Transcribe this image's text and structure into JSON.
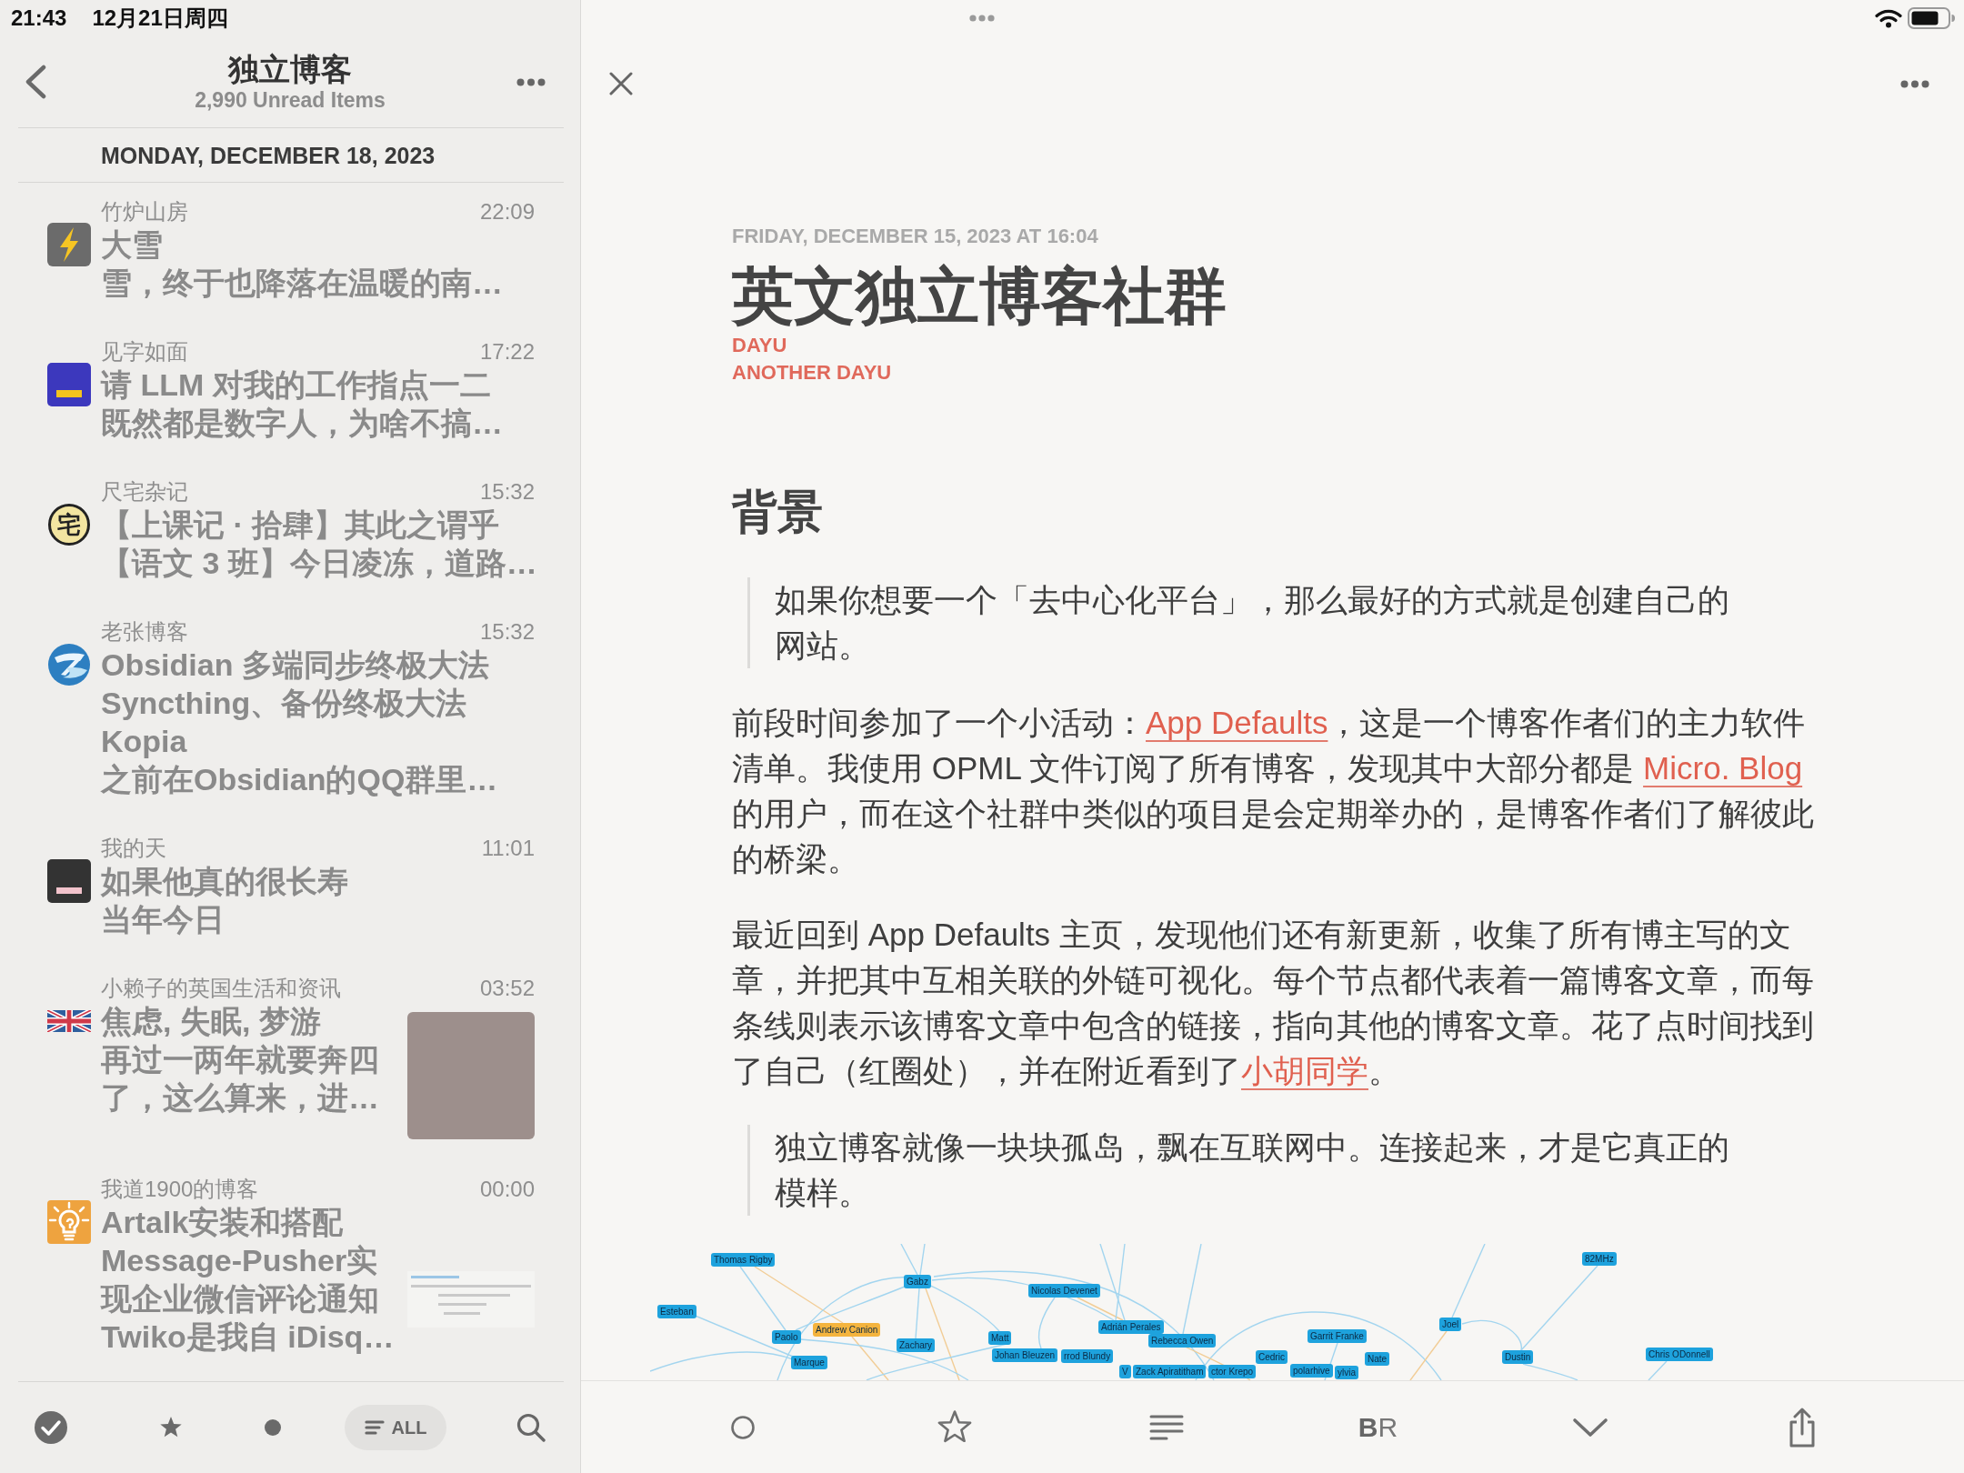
{
  "status_bar": {
    "time": "21:43",
    "date": "12月21日周四"
  },
  "feed_list": {
    "title": "独立博客",
    "subtitle": "2,990 Unread Items",
    "date_header": "MONDAY, DECEMBER 18, 2023",
    "items": [
      {
        "source": "竹炉山房",
        "time": "22:09",
        "title": "大雪",
        "summary": "雪，终于也降落在温暖的南…"
      },
      {
        "source": "见字如面",
        "time": "17:22",
        "title": "请 LLM 对我的工作指点一二",
        "summary": "既然都是数字人，为啥不搞…"
      },
      {
        "source": "尺宅杂记",
        "time": "15:32",
        "logo_text": "宅",
        "title": "【上课记 · 拾肆】其此之谓乎",
        "summary": "【语文 3 班】今日凌冻，道路…"
      },
      {
        "source": "老张博客",
        "time": "15:32",
        "title": "Obsidian 多端同步终极大法 Syncthing、备份终极大法 Kopia",
        "summary": "之前在Obsidian的QQ群里…"
      },
      {
        "source": "我的天",
        "time": "11:01",
        "title": "如果他真的很长寿",
        "summary": "当年今日"
      },
      {
        "source": "小赖子的英国生活和资讯",
        "time": "03:52",
        "title": "焦虑, 失眠, 梦游",
        "summary": "再过一两年就要奔四了，这么算来，进…",
        "thumbnail": {
          "kind": "photo"
        }
      },
      {
        "source": "我道1900的博客",
        "time": "00:00",
        "title": "Artalk安装和搭配 Message-Pusher实现企业微信评论通知",
        "summary": "Twiko是我自 iDisq…",
        "thumbnail": {
          "kind": "document"
        }
      }
    ]
  },
  "list_toolbar": {
    "filters": [
      {
        "kind": "starred",
        "selected": false
      },
      {
        "kind": "unread",
        "selected": false
      },
      {
        "kind": "all",
        "label": "ALL",
        "selected": true
      }
    ]
  },
  "article": {
    "dateline": "FRIDAY, DECEMBER 15, 2023 AT 16:04",
    "title": "英文独立博客社群",
    "authors": [
      "DAYU",
      "ANOTHER DAYU"
    ],
    "blocks": [
      {
        "kind": "heading",
        "text": "背景"
      },
      {
        "kind": "quote",
        "text": "如果你想要一个「去中心化平台」，那么最好的方式就是创建自己的网站。"
      },
      {
        "kind": "paragraph",
        "segments": [
          {
            "kind": "text",
            "text": "前段时间参加了一个小活动："
          },
          {
            "kind": "link",
            "text": "App Defaults"
          },
          {
            "kind": "text",
            "text": "，这是一个博客作者们的主力软件清单。我使用 OPML 文件订阅了所有博客，发现其中大部分都是 "
          },
          {
            "kind": "link",
            "text": "Micro. Blog"
          },
          {
            "kind": "text",
            "text": "的用户，而在这个社群中类似的项目是会定期举办的，是博客作者们了解彼此的桥梁。"
          }
        ]
      },
      {
        "kind": "paragraph",
        "segments": [
          {
            "kind": "text",
            "text": "最近回到 App Defaults 主页，发现他们还有新更新，收集了所有博主写的文章，并把其中互相关联的外链可视化。每个节点都代表着一篇博客文章，而每条线则表示该博客文章中包含的链接，指向其他的博客文章。花了点时间找到了自己（红圈处），并在附近看到了"
          },
          {
            "kind": "link",
            "text": "小胡同学"
          },
          {
            "kind": "text",
            "text": "。"
          }
        ]
      },
      {
        "kind": "quote",
        "text": "独立博客就像一块块孤岛，飘在互联网中。连接起来，才是它真正的模样。"
      },
      {
        "kind": "graph_image",
        "nodes": [
          {
            "label": "Thomas Rigby",
            "color": "#1ea2dd"
          },
          {
            "label": "82MHz",
            "color": "#1ea2dd"
          },
          {
            "label": "Gabz",
            "color": "#1ea2dd"
          },
          {
            "label": "Nicolas Devenet",
            "color": "#1ea2dd"
          },
          {
            "label": "Esteban",
            "color": "#1ea2dd"
          },
          {
            "label": "Paolo",
            "color": "#1ea2dd"
          },
          {
            "label": "Andrew Canion",
            "color": "#f4b43e"
          },
          {
            "label": "Zachary",
            "color": "#1ea2dd"
          },
          {
            "label": "Matt",
            "color": "#1ea2dd"
          },
          {
            "label": "Adrián Perales",
            "color": "#1ea2dd"
          },
          {
            "label": "Rebecca Owen",
            "color": "#1ea2dd"
          },
          {
            "label": "Garrit Franke",
            "color": "#1ea2dd"
          },
          {
            "label": "Joel",
            "color": "#1ea2dd"
          },
          {
            "label": "Marque",
            "color": "#1ea2dd"
          },
          {
            "label": "Johan Bleuzen",
            "color": "#1ea2dd"
          },
          {
            "label": "rrod Blundy",
            "color": "#1ea2dd"
          },
          {
            "label": "Cedric",
            "color": "#1ea2dd"
          },
          {
            "label": "Nate",
            "color": "#1ea2dd"
          },
          {
            "label": "Dustin",
            "color": "#1ea2dd"
          },
          {
            "label": "Chris ODonnell",
            "color": "#1ea2dd"
          },
          {
            "label": "V",
            "color": "#1ea2dd"
          },
          {
            "label": "Zack Apiratitham",
            "color": "#1ea2dd"
          },
          {
            "label": "ctor Krepo",
            "color": "#1ea2dd"
          },
          {
            "label": "polarhive",
            "color": "#1ea2dd"
          },
          {
            "label": "ylvia",
            "color": "#1ea2dd"
          }
        ]
      }
    ]
  },
  "article_toolbar": [
    {
      "kind": "unread",
      "on": false
    },
    {
      "kind": "star",
      "on": false
    },
    {
      "kind": "reader"
    },
    {
      "kind": "bionic",
      "label": "**B**R"
    },
    {
      "kind": "next"
    },
    {
      "kind": "share"
    }
  ]
}
